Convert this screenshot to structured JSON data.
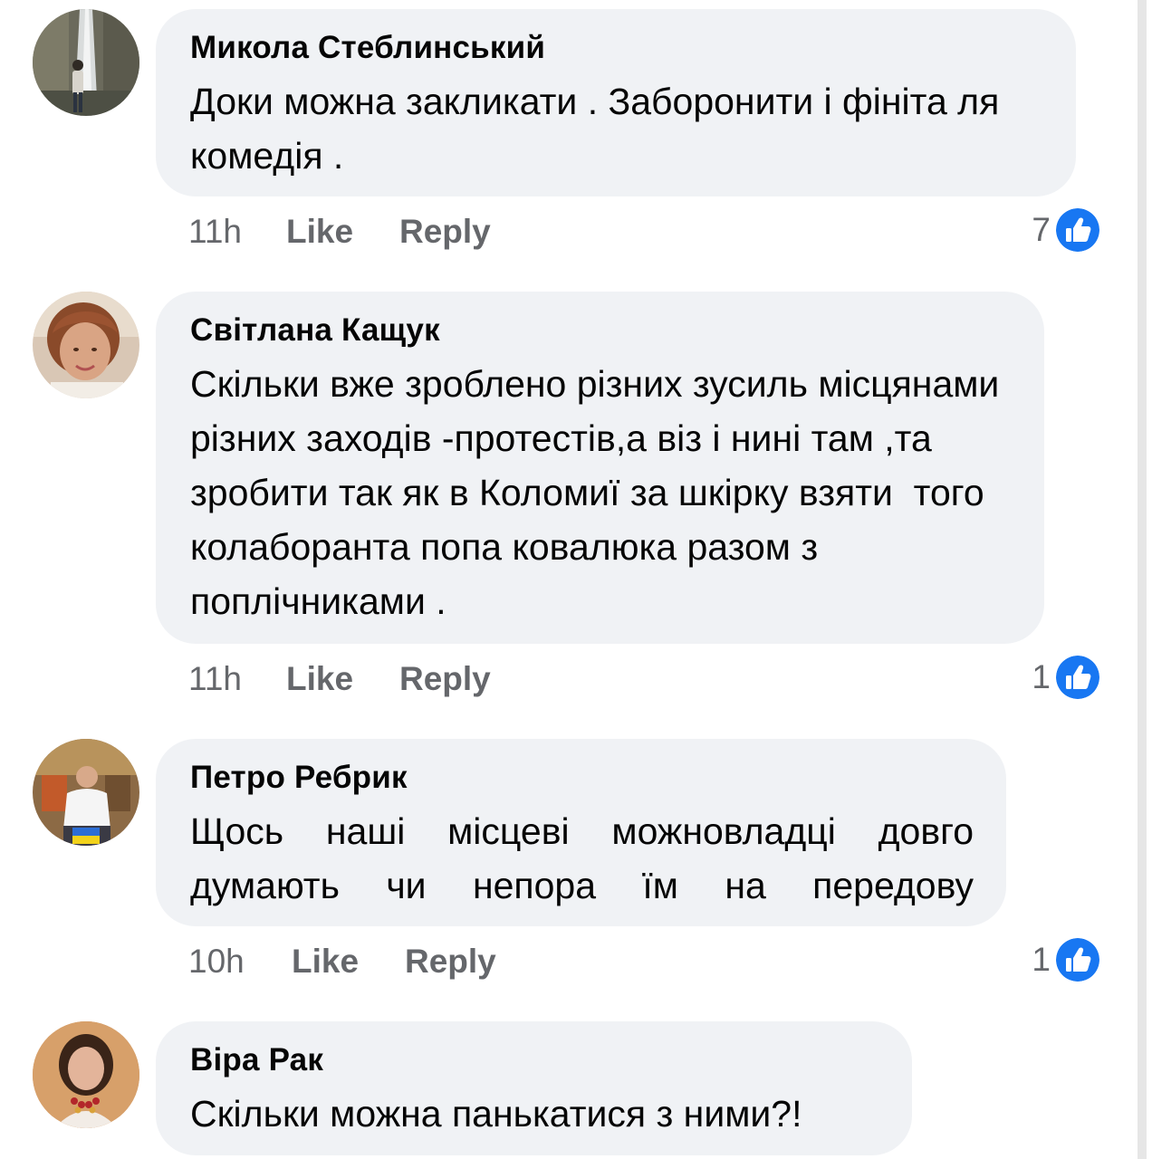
{
  "comments": [
    {
      "author": "Микола Стеблинський",
      "text": "Доки можна закликати . Заборонити і фініта ля комедія .",
      "time": "11h",
      "like_label": "Like",
      "reply_label": "Reply",
      "reaction_count": "7",
      "avatar_icon": "avatar-photo-waterfall"
    },
    {
      "author": "Світлана Кащук",
      "text": "Скільки вже зроблено різних зусиль місцянами різних заходів -протестів,а віз і нині там ,та зробити так як в Коломиї за шкірку взяти  того колаборанта попа ковалюка разом з поплічниками .",
      "time": "11h",
      "like_label": "Like",
      "reply_label": "Reply",
      "reaction_count": "1",
      "avatar_icon": "avatar-photo-woman"
    },
    {
      "author": "Петро Ребрик",
      "text": "Щось наші місцеві можновладці довго думають чи непора їм на передову",
      "time": "10h",
      "like_label": "Like",
      "reply_label": "Reply",
      "reaction_count": "1",
      "avatar_icon": "avatar-photo-man-flag"
    },
    {
      "author": "Віра Рак",
      "text": "Скільки можна панькатися з ними?!",
      "avatar_icon": "avatar-photo-woman-beads"
    }
  ],
  "colors": {
    "bubble_bg": "#f0f2f5",
    "meta_text": "#65676b",
    "like_blue": "#1877f2"
  },
  "reaction_icon": "like-thumb-icon"
}
